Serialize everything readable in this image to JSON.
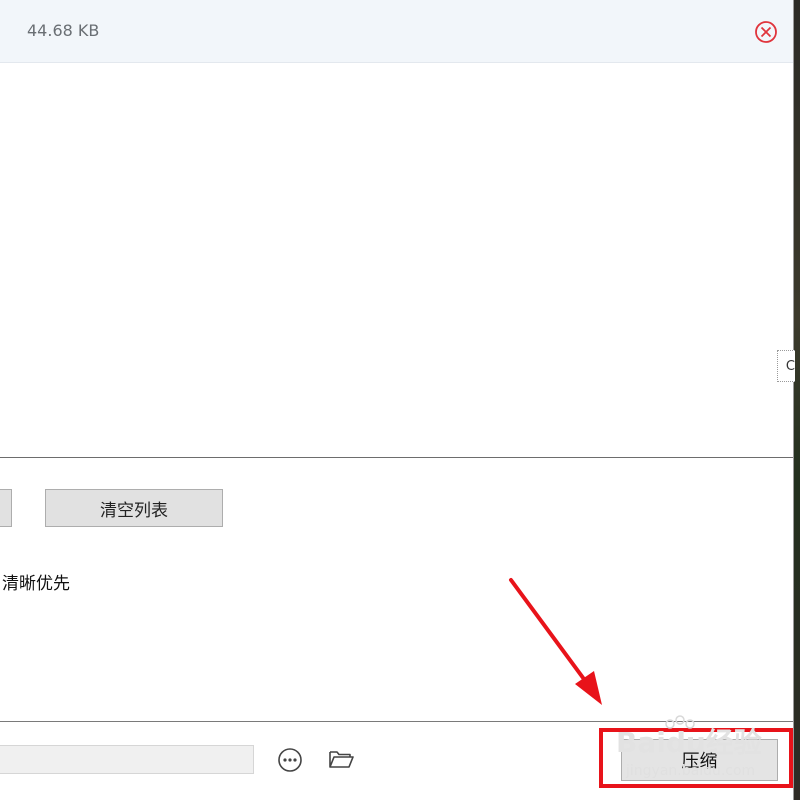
{
  "file_row": {
    "size": "44.68 KB"
  },
  "buttons": {
    "clear_list": "清空列表",
    "compress": "压缩"
  },
  "options": {
    "quality_label": "清晰优先"
  },
  "bottom_bar": {
    "path_value": ""
  },
  "side_tab": {
    "label": "C"
  },
  "watermark": {
    "brand": "Baidu经验",
    "url": "jingyan.baidu.com"
  },
  "colors": {
    "annotation_red": "#e8131a",
    "remove_icon_red": "#e0343c"
  }
}
